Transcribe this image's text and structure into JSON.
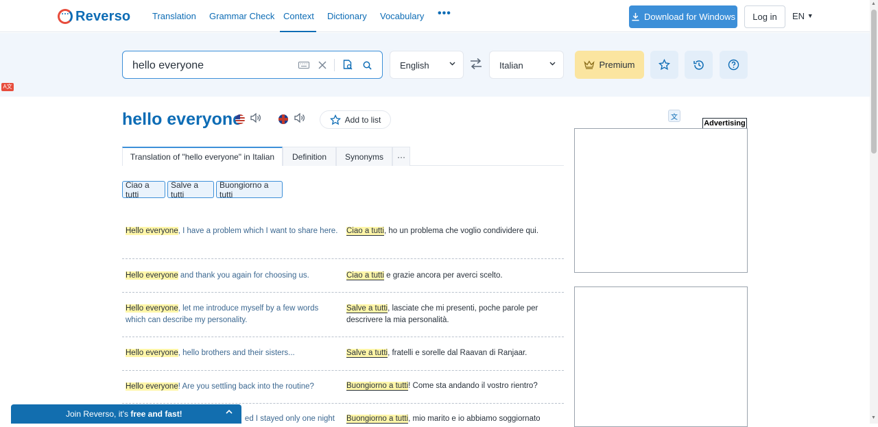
{
  "brand": {
    "name": "Reverso"
  },
  "nav": [
    {
      "label": "Translation"
    },
    {
      "label": "Grammar Check"
    },
    {
      "label": "Context"
    },
    {
      "label": "Dictionary"
    },
    {
      "label": "Vocabulary"
    }
  ],
  "nav_more": "•••",
  "header": {
    "download_label": "Download for Windows",
    "login_label": "Log in",
    "ui_lang": "EN"
  },
  "search": {
    "query": "hello everyone",
    "source_lang": "English",
    "target_lang": "Italian",
    "premium_label": "Premium"
  },
  "word": {
    "title": "hello everyone",
    "add_to_list": "Add to list"
  },
  "tabs": [
    {
      "label": "Translation of \"hello everyone\" in Italian"
    },
    {
      "label": "Definition"
    },
    {
      "label": "Synonyms"
    },
    {
      "label": "···"
    }
  ],
  "translations": [
    "Ciao a tutti",
    "Salve a tutti",
    "Buongiorno a tutti"
  ],
  "examples": [
    {
      "src_hl": "Hello everyone",
      "src_rest": ", I have a problem which I want to share here.",
      "trg_hl": "Ciao a tutti",
      "trg_rest": ", ho un problema che voglio condividere qui."
    },
    {
      "src_hl": "Hello everyone",
      "src_rest": " and thank you again for choosing us.",
      "trg_hl": "Ciao a tutti",
      "trg_rest": " e grazie ancora per averci scelto."
    },
    {
      "src_hl": "Hello everyone",
      "src_rest": ", let me introduce myself by a few words which can describe my personality.",
      "trg_hl": "Salve a tutti",
      "trg_rest": ", lasciate che mi presenti, poche parole per descrivere la mia personalità."
    },
    {
      "src_hl": "Hello everyone",
      "src_rest": ", hello brothers and their sisters...",
      "trg_hl": "Salve a tutti",
      "trg_rest": ", fratelli e sorelle dal Raavan di Ranjaar."
    },
    {
      "src_hl": "Hello everyone",
      "src_rest": "! Are you settling back into the routine?",
      "trg_hl": "Buongiorno a tutti",
      "trg_rest": "! Come sta andando il vostro rientro?"
    },
    {
      "src_hl": "",
      "src_rest": "ed I stayed only one night",
      "trg_hl": "Buongiorno a tutti",
      "trg_rest": ", mio marito e io abbiamo soggiornato"
    }
  ],
  "ads": {
    "label": "Advertising"
  },
  "join": {
    "text": "Join Reverso, it's ",
    "bold": "free and fast!"
  },
  "colors": {
    "brand": "#0d6cb5",
    "premium": "#fbe5a0",
    "download": "#3c8fd8",
    "join": "#126eaf"
  }
}
